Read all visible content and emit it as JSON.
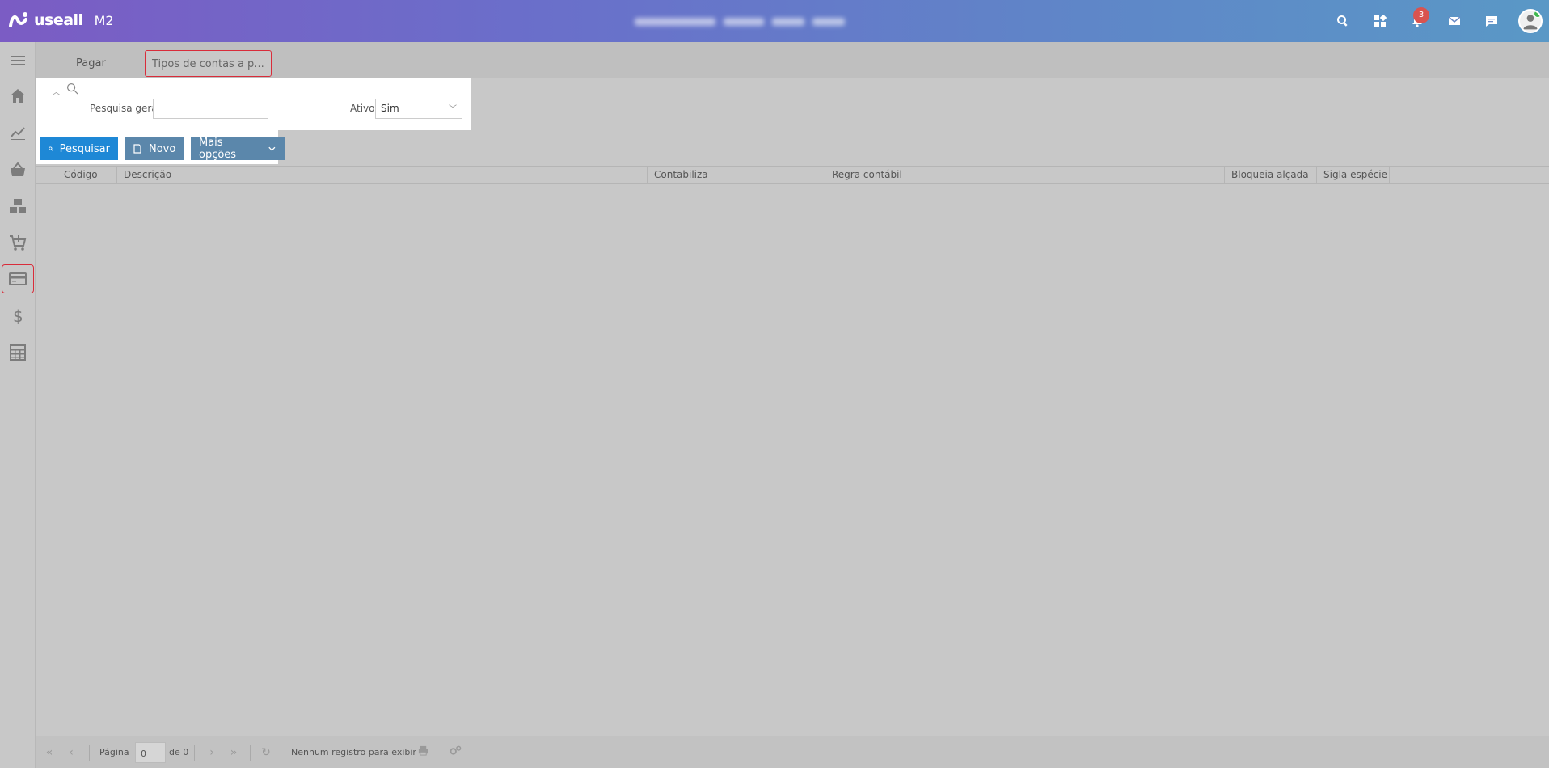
{
  "header": {
    "logo_text": "useall",
    "logo_version": "M2",
    "notifications_count": "3"
  },
  "tabs": [
    {
      "label": "Pagar"
    },
    {
      "label": "Tipos de contas a p..."
    }
  ],
  "filter": {
    "search_label": "Pesquisa geral",
    "search_value": "",
    "active_label": "Ativo",
    "active_value": "Sim"
  },
  "toolbar": {
    "search_button": "Pesquisar",
    "new_button": "Novo",
    "more_button": "Mais opções"
  },
  "grid": {
    "columns": [
      "Código",
      "Descrição",
      "Contabiliza",
      "Regra contábil",
      "Bloqueia alçada",
      "Sigla espécie"
    ]
  },
  "pager": {
    "page_label": "Página",
    "page_value": "0",
    "of_label": "de 0",
    "status": "Nenhum registro para exibir"
  },
  "sidebar": {
    "items": [
      "menu",
      "home",
      "dashboards",
      "purchases",
      "inventory",
      "orders",
      "payables",
      "finance",
      "accounting"
    ]
  }
}
